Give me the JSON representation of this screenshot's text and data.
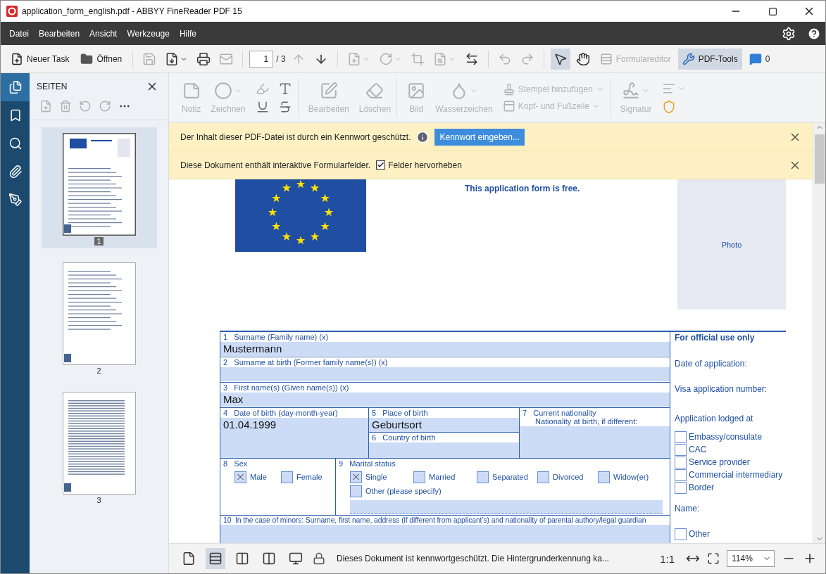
{
  "window": {
    "title": "application_form_english.pdf - ABBYY FineReader PDF 15"
  },
  "menu": [
    "Datei",
    "Bearbeiten",
    "Ansicht",
    "Werkzeuge",
    "Hilfe"
  ],
  "toolbar": {
    "new_task": "Neuer Task",
    "open": "Öffnen",
    "file_tools": [
      {
        "kind": "save",
        "disabled": true,
        "dropdown": false
      },
      {
        "kind": "saveas",
        "disabled": false,
        "dropdown": true
      },
      {
        "kind": "print",
        "disabled": false,
        "dropdown": false
      },
      {
        "kind": "mail",
        "disabled": true,
        "dropdown": false
      }
    ],
    "page": {
      "value": "1",
      "total": "/ 3"
    },
    "nav_tools": [
      {
        "kind": "up",
        "disabled": true,
        "dropdown": false
      },
      {
        "kind": "down",
        "disabled": false,
        "dropdown": false
      }
    ],
    "edit_tools": [
      {
        "kind": "addpage",
        "disabled": true,
        "dropdown": true
      },
      {
        "kind": "rotate",
        "disabled": true,
        "dropdown": true
      },
      {
        "kind": "crop",
        "disabled": true,
        "dropdown": false
      },
      {
        "kind": "inspect",
        "disabled": true,
        "dropdown": true
      },
      {
        "kind": "convert",
        "disabled": false,
        "dropdown": false
      }
    ],
    "history_tools": [
      {
        "kind": "undo",
        "disabled": true,
        "dropdown": false
      },
      {
        "kind": "redo",
        "disabled": true,
        "dropdown": false
      }
    ],
    "modes": [
      {
        "kind": "pointer",
        "selected": true
      },
      {
        "kind": "hand",
        "selected": false
      }
    ],
    "form_editor": {
      "label": "Formulareditor",
      "disabled": true
    },
    "pdf_tools": {
      "label": "PDF-Tools",
      "selected": true
    },
    "comments": "0"
  },
  "rail": [
    {
      "kind": "pages",
      "selected": true
    },
    {
      "kind": "bookmarks",
      "selected": false
    },
    {
      "kind": "search",
      "selected": false
    },
    {
      "kind": "attachments",
      "selected": false
    },
    {
      "kind": "signatures",
      "selected": false
    }
  ],
  "pages_panel": {
    "title": "SEITEN",
    "tools": [
      {
        "kind": "add",
        "disabled": true
      },
      {
        "kind": "delete",
        "disabled": true
      },
      {
        "kind": "rotleft",
        "disabled": true
      },
      {
        "kind": "rotright",
        "disabled": true
      },
      {
        "kind": "more",
        "disabled": false
      }
    ],
    "pages": [
      {
        "label": "1",
        "selected": true,
        "kind": "cover"
      },
      {
        "label": "2",
        "selected": false,
        "kind": "form"
      },
      {
        "label": "3",
        "selected": false,
        "kind": "text"
      }
    ]
  },
  "ribbon": {
    "annotate": [
      {
        "kind": "note",
        "label": "Notiz",
        "disabled": true,
        "dropdown": false
      },
      {
        "kind": "draw",
        "label": "Zeichnen",
        "disabled": true,
        "dropdown": true
      }
    ],
    "markup": [
      {
        "kind": "highlight",
        "disabled": true
      },
      {
        "kind": "insert",
        "disabled": false
      },
      {
        "kind": "underline",
        "disabled": false
      },
      {
        "kind": "strike",
        "disabled": false
      }
    ],
    "edit": [
      {
        "kind": "edit",
        "label": "Bearbeiten",
        "disabled": true,
        "dropdown": false
      },
      {
        "kind": "erase",
        "label": "Löschen",
        "disabled": true,
        "dropdown": false
      }
    ],
    "insert": [
      {
        "kind": "image",
        "label": "Bild",
        "disabled": true,
        "dropdown": false
      },
      {
        "kind": "watermark",
        "label": "Wasserzeichen",
        "disabled": true,
        "dropdown": true
      }
    ],
    "page_marks": [
      {
        "kind": "stamp",
        "label": "Stempel hinzufügen",
        "disabled": true,
        "dropdown": true
      },
      {
        "kind": "header",
        "label": "Kopf- und Fußzeile",
        "disabled": true,
        "dropdown": true
      }
    ],
    "sign": [
      {
        "kind": "signature",
        "label": "Signatur",
        "disabled": true,
        "dropdown": true
      }
    ],
    "extras": [
      {
        "kind": "redact",
        "disabled": true,
        "dropdown": true
      },
      {
        "kind": "shield",
        "disabled": false,
        "dropdown": false
      }
    ]
  },
  "notifications": [
    {
      "kind": "password",
      "text": "Der Inhalt dieser PDF-Datei ist durch ein Kennwort geschützt.",
      "button": "Kennwort eingeben..."
    },
    {
      "kind": "fields",
      "text": "Diese Dokument enthält interaktive Formularfelder.",
      "checkbox": {
        "label": "Felder hervorheben",
        "checked": true
      }
    }
  ],
  "document": {
    "subtitle": "This application form is free.",
    "photo": "Photo",
    "form": {
      "surname": {
        "number": "1",
        "label": "Surname (Family name) (x)",
        "value": "Mustermann"
      },
      "birth_surname": {
        "number": "2",
        "label": "Surname at birth (Former family name(s)) (x)"
      },
      "first_name": {
        "number": "3",
        "label": "First name(s) (Given name(s)) (x)",
        "value": "Max"
      },
      "birth_date": {
        "number": "4",
        "label": "Date of birth (day-month-year)",
        "value": "01.04.1999"
      },
      "birth_place": {
        "number": "5",
        "label": "Place of birth",
        "value": "Geburtsort"
      },
      "birth_country": {
        "number": "6",
        "label": "Country of birth"
      },
      "nationality": {
        "number": "7",
        "label": "Current nationality",
        "label_2": "Nationality at birth, if different:"
      },
      "sex": {
        "number": "8",
        "label": "Sex",
        "options": [
          {
            "label": "Male",
            "checked": true
          },
          {
            "label": "Female",
            "checked": false
          }
        ]
      },
      "marital": {
        "number": "9",
        "label": "Marital status",
        "options": [
          {
            "label": "Single",
            "checked": true
          },
          {
            "label": "Married",
            "checked": false
          },
          {
            "label": "Separated",
            "checked": false
          },
          {
            "label": "Divorced",
            "checked": false
          },
          {
            "label": "Widow(er)",
            "checked": false
          },
          {
            "label": "Other (please specify)",
            "checked": false
          }
        ]
      },
      "minors": {
        "number": "10",
        "label": "In the case of minors: Surname, first name, address (if different from applicant’s) and nationality of parental authory/legal guardian"
      }
    },
    "official": {
      "title": "For official use only",
      "lines": [
        "Date of application:",
        "Visa application number:"
      ],
      "lodged": "Application lodged at",
      "options": [
        {
          "label": "Embassy/consulate",
          "checked": false
        },
        {
          "label": "CAC",
          "checked": false
        },
        {
          "label": "Service provider",
          "checked": false
        },
        {
          "label": "Commercial intermediary",
          "checked": false
        },
        {
          "label": "Border",
          "checked": false
        }
      ],
      "name": "Name:",
      "other": {
        "label": "Other",
        "checked": false
      }
    }
  },
  "status_bar": {
    "views": [
      {
        "kind": "single",
        "selected": false
      },
      {
        "kind": "scroll",
        "selected": true
      },
      {
        "kind": "spread",
        "selected": false
      },
      {
        "kind": "spreadscroll",
        "selected": false
      },
      {
        "kind": "present",
        "selected": false
      }
    ],
    "message": "Dieses Dokument ist kennwortgeschützt. Die Hintergrunderkennung ka...",
    "actual_size": "1:1",
    "zoom": "114%"
  }
}
